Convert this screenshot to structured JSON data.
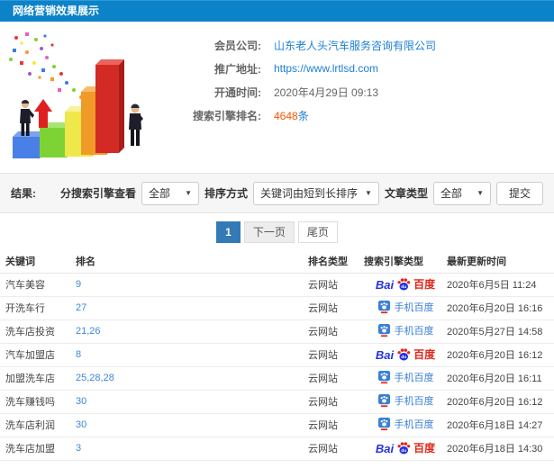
{
  "header": {
    "title": "网络营销效果展示",
    "bar_color": "#0c82c8"
  },
  "info": {
    "company_label": "会员公司:",
    "company_value": "山东老人头汽车服务咨询有限公司",
    "url_label": "推广地址:",
    "url_value": "https://www.lrtlsd.com",
    "opened_label": "开通时间:",
    "opened_value": "2020年4月29日 09:13",
    "rank_label": "搜索引擎排名:",
    "rank_count": "4648",
    "rank_unit": "条",
    "highlight_color": "#ff5500",
    "link_color": "#1b7fd6"
  },
  "filters": {
    "result_label": "结果:",
    "engine_label": "分搜索引擎查看",
    "engine_value": "全部",
    "sort_label": "排序方式",
    "sort_value": "关键词由短到长排序",
    "article_label": "文章类型",
    "article_value": "全部",
    "submit_label": "提交"
  },
  "pagination": {
    "current": "1",
    "next": "下一页",
    "last": "尾页",
    "active_color": "#337ab7"
  },
  "table": {
    "headers": [
      "关键词",
      "排名",
      "排名类型",
      "搜索引擎类型",
      "最新更新时间"
    ],
    "rows": [
      {
        "keyword": "汽车美容",
        "rank": "9",
        "rank_type": "云网站",
        "engine": "baidu",
        "updated": "2020年6月5日 11:24"
      },
      {
        "keyword": "开洗车行",
        "rank": "27",
        "rank_type": "云网站",
        "engine": "mobile-baidu",
        "updated": "2020年6月20日 16:16"
      },
      {
        "keyword": "洗车店投资",
        "rank": "21,26",
        "rank_type": "云网站",
        "engine": "mobile-baidu",
        "updated": "2020年5月27日 14:58"
      },
      {
        "keyword": "汽车加盟店",
        "rank": "8",
        "rank_type": "云网站",
        "engine": "baidu",
        "updated": "2020年6月20日 16:12"
      },
      {
        "keyword": "加盟洗车店",
        "rank": "25,28,28",
        "rank_type": "云网站",
        "engine": "mobile-baidu",
        "updated": "2020年6月20日 16:11"
      },
      {
        "keyword": "洗车赚钱吗",
        "rank": "30",
        "rank_type": "云网站",
        "engine": "mobile-baidu",
        "updated": "2020年6月20日 16:12"
      },
      {
        "keyword": "洗车店利润",
        "rank": "30",
        "rank_type": "云网站",
        "engine": "mobile-baidu",
        "updated": "2020年6月18日 14:27"
      },
      {
        "keyword": "洗车店加盟",
        "rank": "3",
        "rank_type": "云网站",
        "engine": "baidu",
        "updated": "2020年6月18日 14:30"
      }
    ],
    "engine_logos": {
      "baidu_prefix": "Bai",
      "baidu_suffix": "百度",
      "mobile_label": "手机百度"
    }
  }
}
